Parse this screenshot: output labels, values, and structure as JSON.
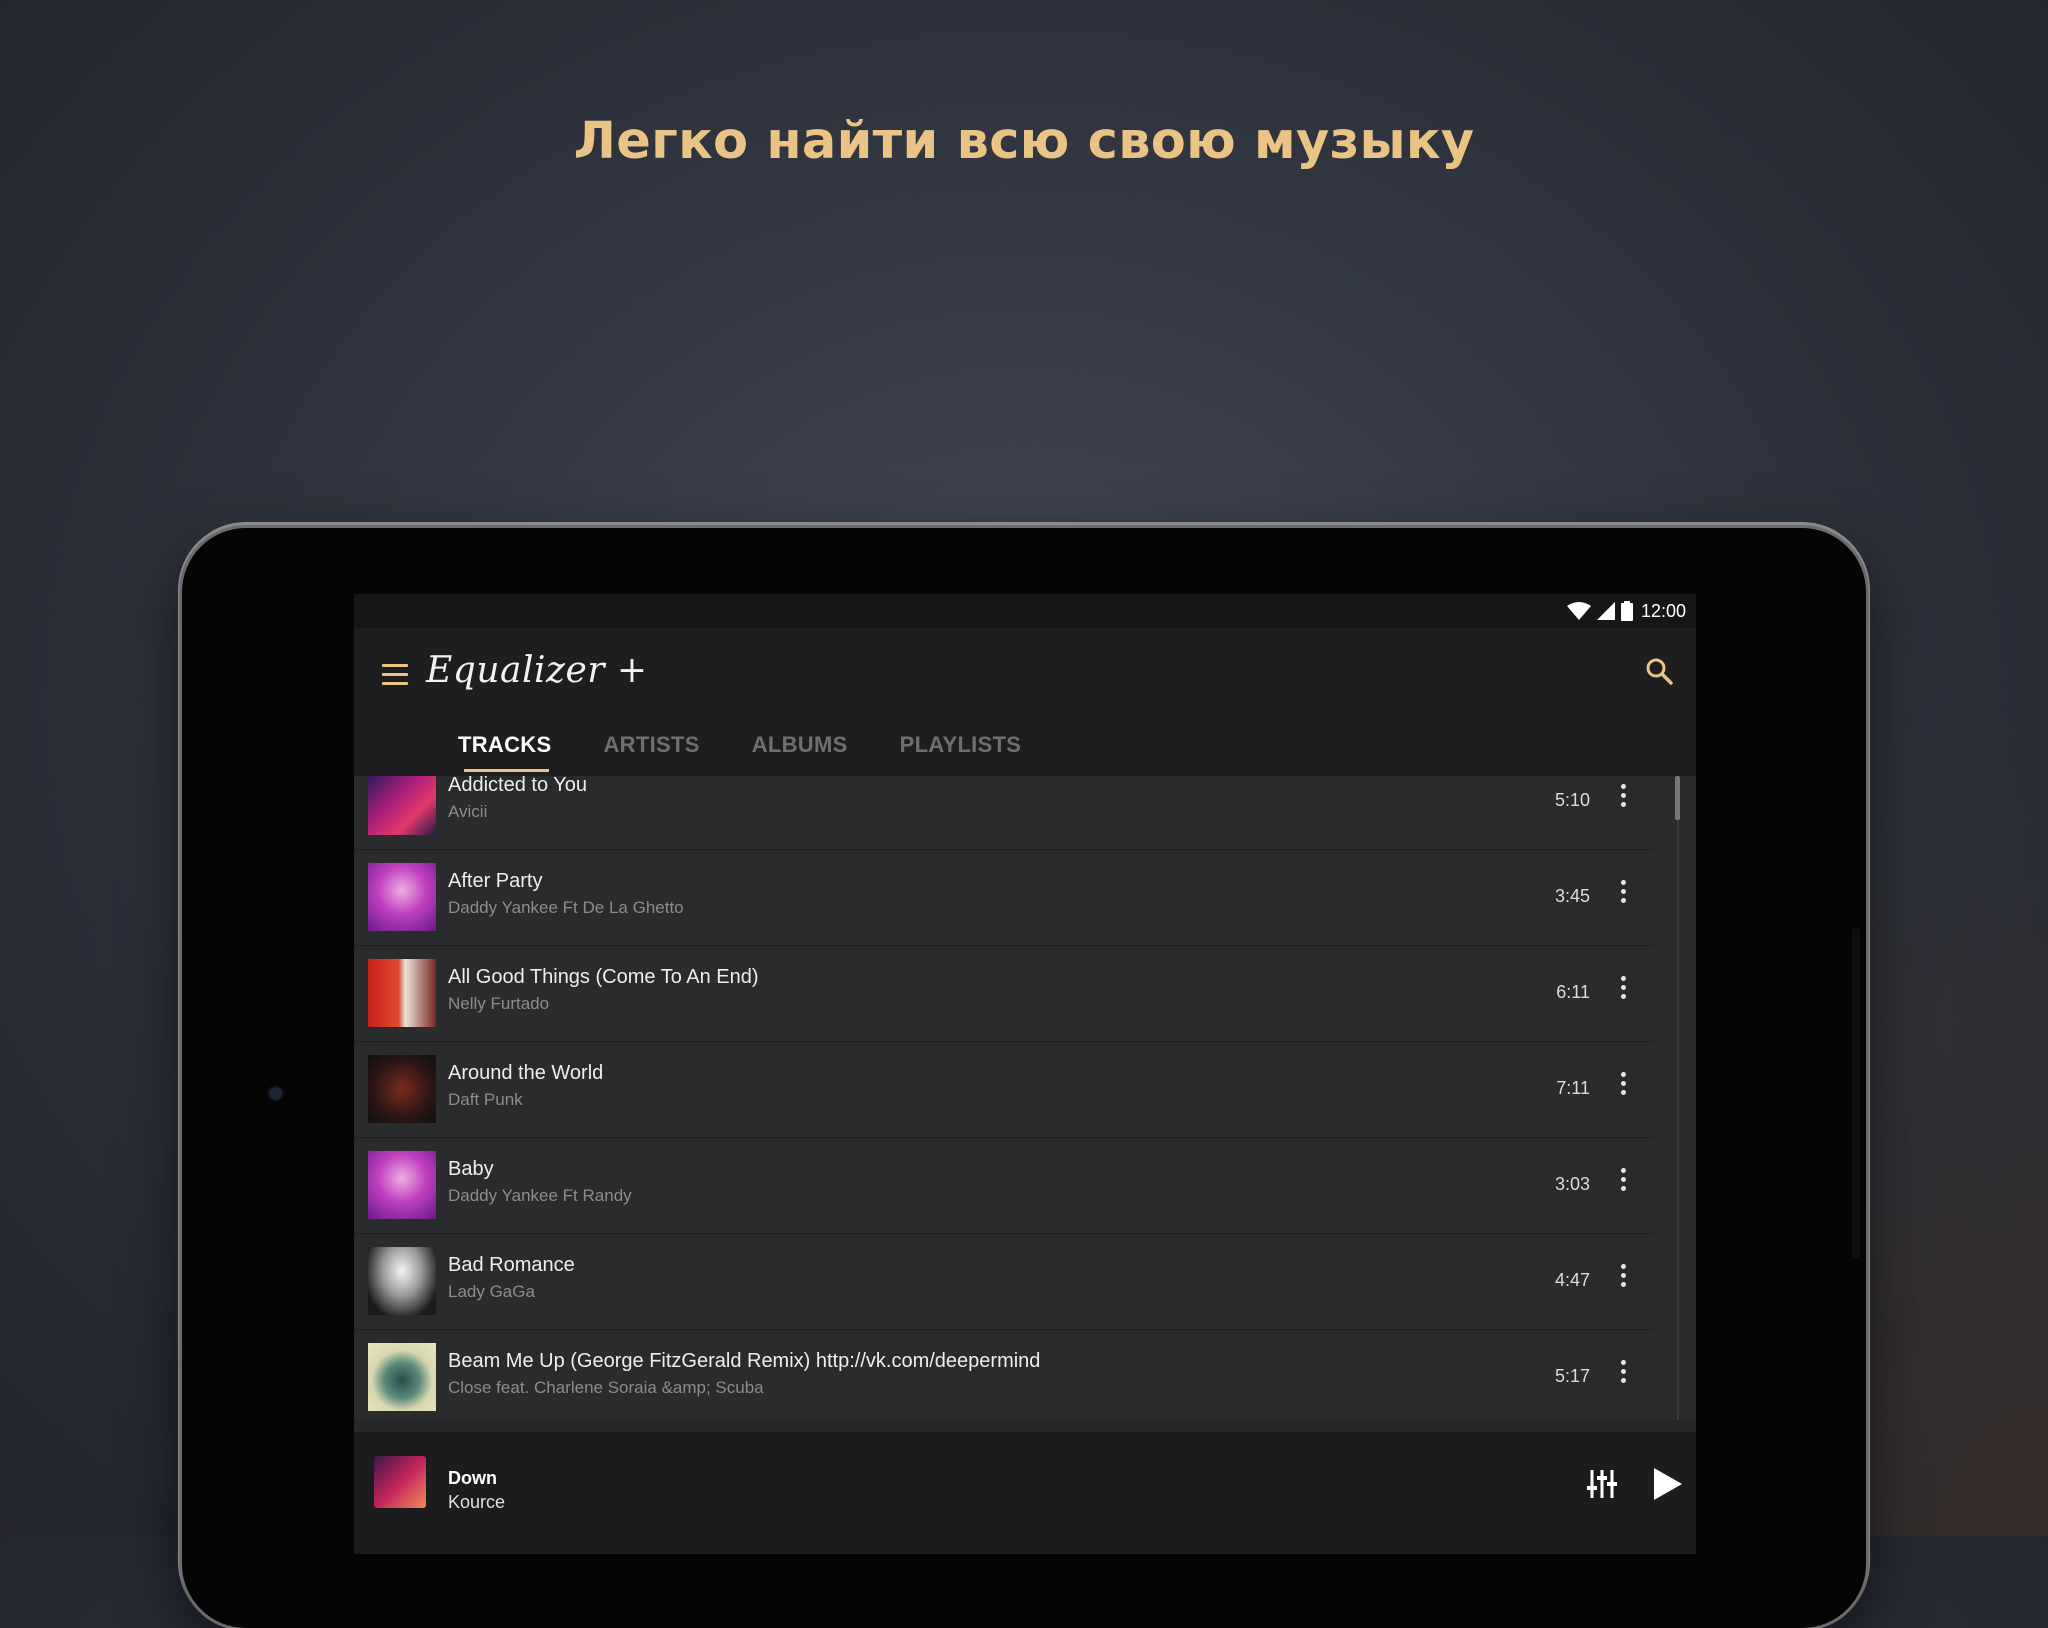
{
  "headline": "Легко найти всю свою музыку",
  "status": {
    "time": "12:00"
  },
  "app": {
    "title": "Equalizer +"
  },
  "tabs": [
    {
      "label": "TRACKS",
      "active": true
    },
    {
      "label": "ARTISTS",
      "active": false
    },
    {
      "label": "ALBUMS",
      "active": false
    },
    {
      "label": "PLAYLISTS",
      "active": false
    }
  ],
  "tracks": [
    {
      "title": "Addicted to You",
      "artist": "Avicii",
      "duration": "5:10"
    },
    {
      "title": "After Party",
      "artist": "Daddy Yankee Ft De La Ghetto",
      "duration": "3:45"
    },
    {
      "title": "All Good Things (Come To An End)",
      "artist": "Nelly Furtado",
      "duration": "6:11"
    },
    {
      "title": "Around the World",
      "artist": "Daft Punk",
      "duration": "7:11"
    },
    {
      "title": "Baby",
      "artist": "Daddy Yankee Ft Randy",
      "duration": "3:03"
    },
    {
      "title": "Bad Romance",
      "artist": "Lady GaGa",
      "duration": "4:47"
    },
    {
      "title": "Beam Me Up (George FitzGerald Remix) http://vk.com/deepermind",
      "artist": "Close feat. Charlene Soraia &amp; Scuba",
      "duration": "5:17"
    }
  ],
  "now_playing": {
    "title": "Down",
    "artist": "Kource"
  },
  "colors": {
    "accent": "#e9c484",
    "background": "#2a2b2d",
    "appbar": "#1e1e20"
  },
  "icons": {
    "menu": "menu-icon",
    "search": "search-icon",
    "more": "more-vert-icon",
    "equalizer": "equalizer-icon",
    "play": "play-icon"
  }
}
